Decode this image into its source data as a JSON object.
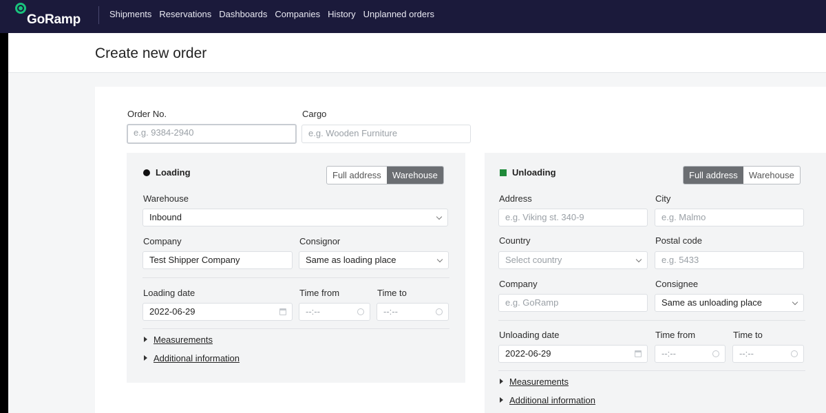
{
  "app": {
    "logo_text": "GoRamp",
    "nav": [
      "Shipments",
      "Reservations",
      "Dashboards",
      "Companies",
      "History",
      "Unplanned orders"
    ]
  },
  "page": {
    "title": "Create new order"
  },
  "order": {
    "order_no_label": "Order No.",
    "order_no_placeholder": "e.g. 9384-2940",
    "cargo_label": "Cargo",
    "cargo_placeholder": "e.g. Wooden Furniture"
  },
  "loading": {
    "title": "Loading",
    "toggle": [
      "Full address",
      "Warehouse"
    ],
    "toggle_active": "Warehouse",
    "warehouse_label": "Warehouse",
    "warehouse_value": "Inbound",
    "company_label": "Company",
    "company_value": "Test Shipper Company",
    "consignor_label": "Consignor",
    "consignor_value": "Same as loading place",
    "date_label": "Loading date",
    "date_value": "2022-06-29",
    "time_from_label": "Time from",
    "time_from_placeholder": "--:--",
    "time_to_label": "Time to",
    "time_to_placeholder": "--:--",
    "measurements": "Measurements",
    "additional": "Additional information",
    "marker_color": "#111111"
  },
  "unloading": {
    "title": "Unloading",
    "toggle": [
      "Full address",
      "Warehouse"
    ],
    "toggle_active": "Full address",
    "address_label": "Address",
    "address_placeholder": "e.g. Viking st. 340-9",
    "city_label": "City",
    "city_placeholder": "e.g. Malmo",
    "country_label": "Country",
    "country_placeholder": "Select country",
    "postal_label": "Postal code",
    "postal_placeholder": "e.g. 5433",
    "company_label": "Company",
    "company_placeholder": "e.g. GoRamp",
    "consignee_label": "Consignee",
    "consignee_value": "Same as unloading place",
    "date_label": "Unloading date",
    "date_value": "2022-06-29",
    "time_from_label": "Time from",
    "time_from_placeholder": "--:--",
    "time_to_label": "Time to",
    "time_to_placeholder": "--:--",
    "measurements": "Measurements",
    "additional": "Additional information",
    "marker_color": "#1f8a3a"
  }
}
